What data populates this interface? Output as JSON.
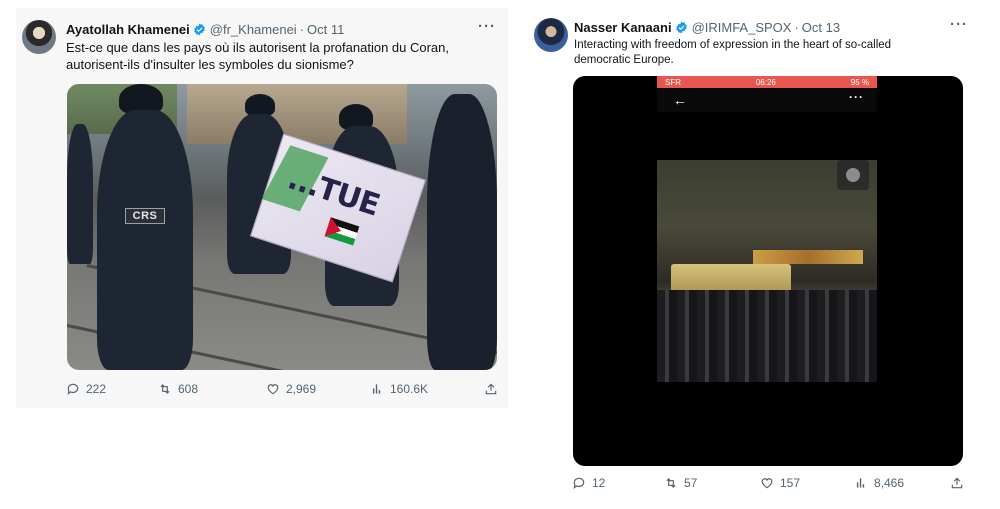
{
  "tweets": [
    {
      "author": {
        "name": "Ayatollah Khamenei",
        "handle": "@fr_Khamenei",
        "date": "Oct 11",
        "verified": true,
        "avatar_icon": "avatar-icon"
      },
      "text": "Est-ce que dans les pays où ils autorisent la profanation du Coran, autorisent-ils d'insulter les symboles du sionisme?",
      "media": {
        "patch_label": "CRS",
        "banner_text": "...TUE"
      },
      "stats": {
        "replies": "222",
        "retweets": "608",
        "likes": "2,969",
        "views": "160.6K"
      }
    },
    {
      "author": {
        "name": "Nasser Kanaani",
        "handle": "@IRIMFA_SPOX",
        "date": "Oct 13",
        "verified": true,
        "avatar_icon": "avatar-icon"
      },
      "text": "Interacting with freedom of expression in the heart of so-called democratic Europe.",
      "media": {
        "status_carrier": "SFR",
        "status_time": "06:26",
        "status_battery": "95 %"
      },
      "stats": {
        "replies": "12",
        "retweets": "57",
        "likes": "157",
        "views": "8,466"
      }
    }
  ],
  "separator": "·",
  "more_label": "···",
  "colors": {
    "text_primary": "#0f1419",
    "text_secondary": "#536471",
    "verified_blue": "#1d9bf0",
    "card_bg": "#f7f7f7"
  },
  "icons": [
    "more-icon",
    "verified-icon",
    "reply-icon",
    "retweet-icon",
    "like-icon",
    "views-icon",
    "share-icon",
    "back-arrow-icon"
  ]
}
